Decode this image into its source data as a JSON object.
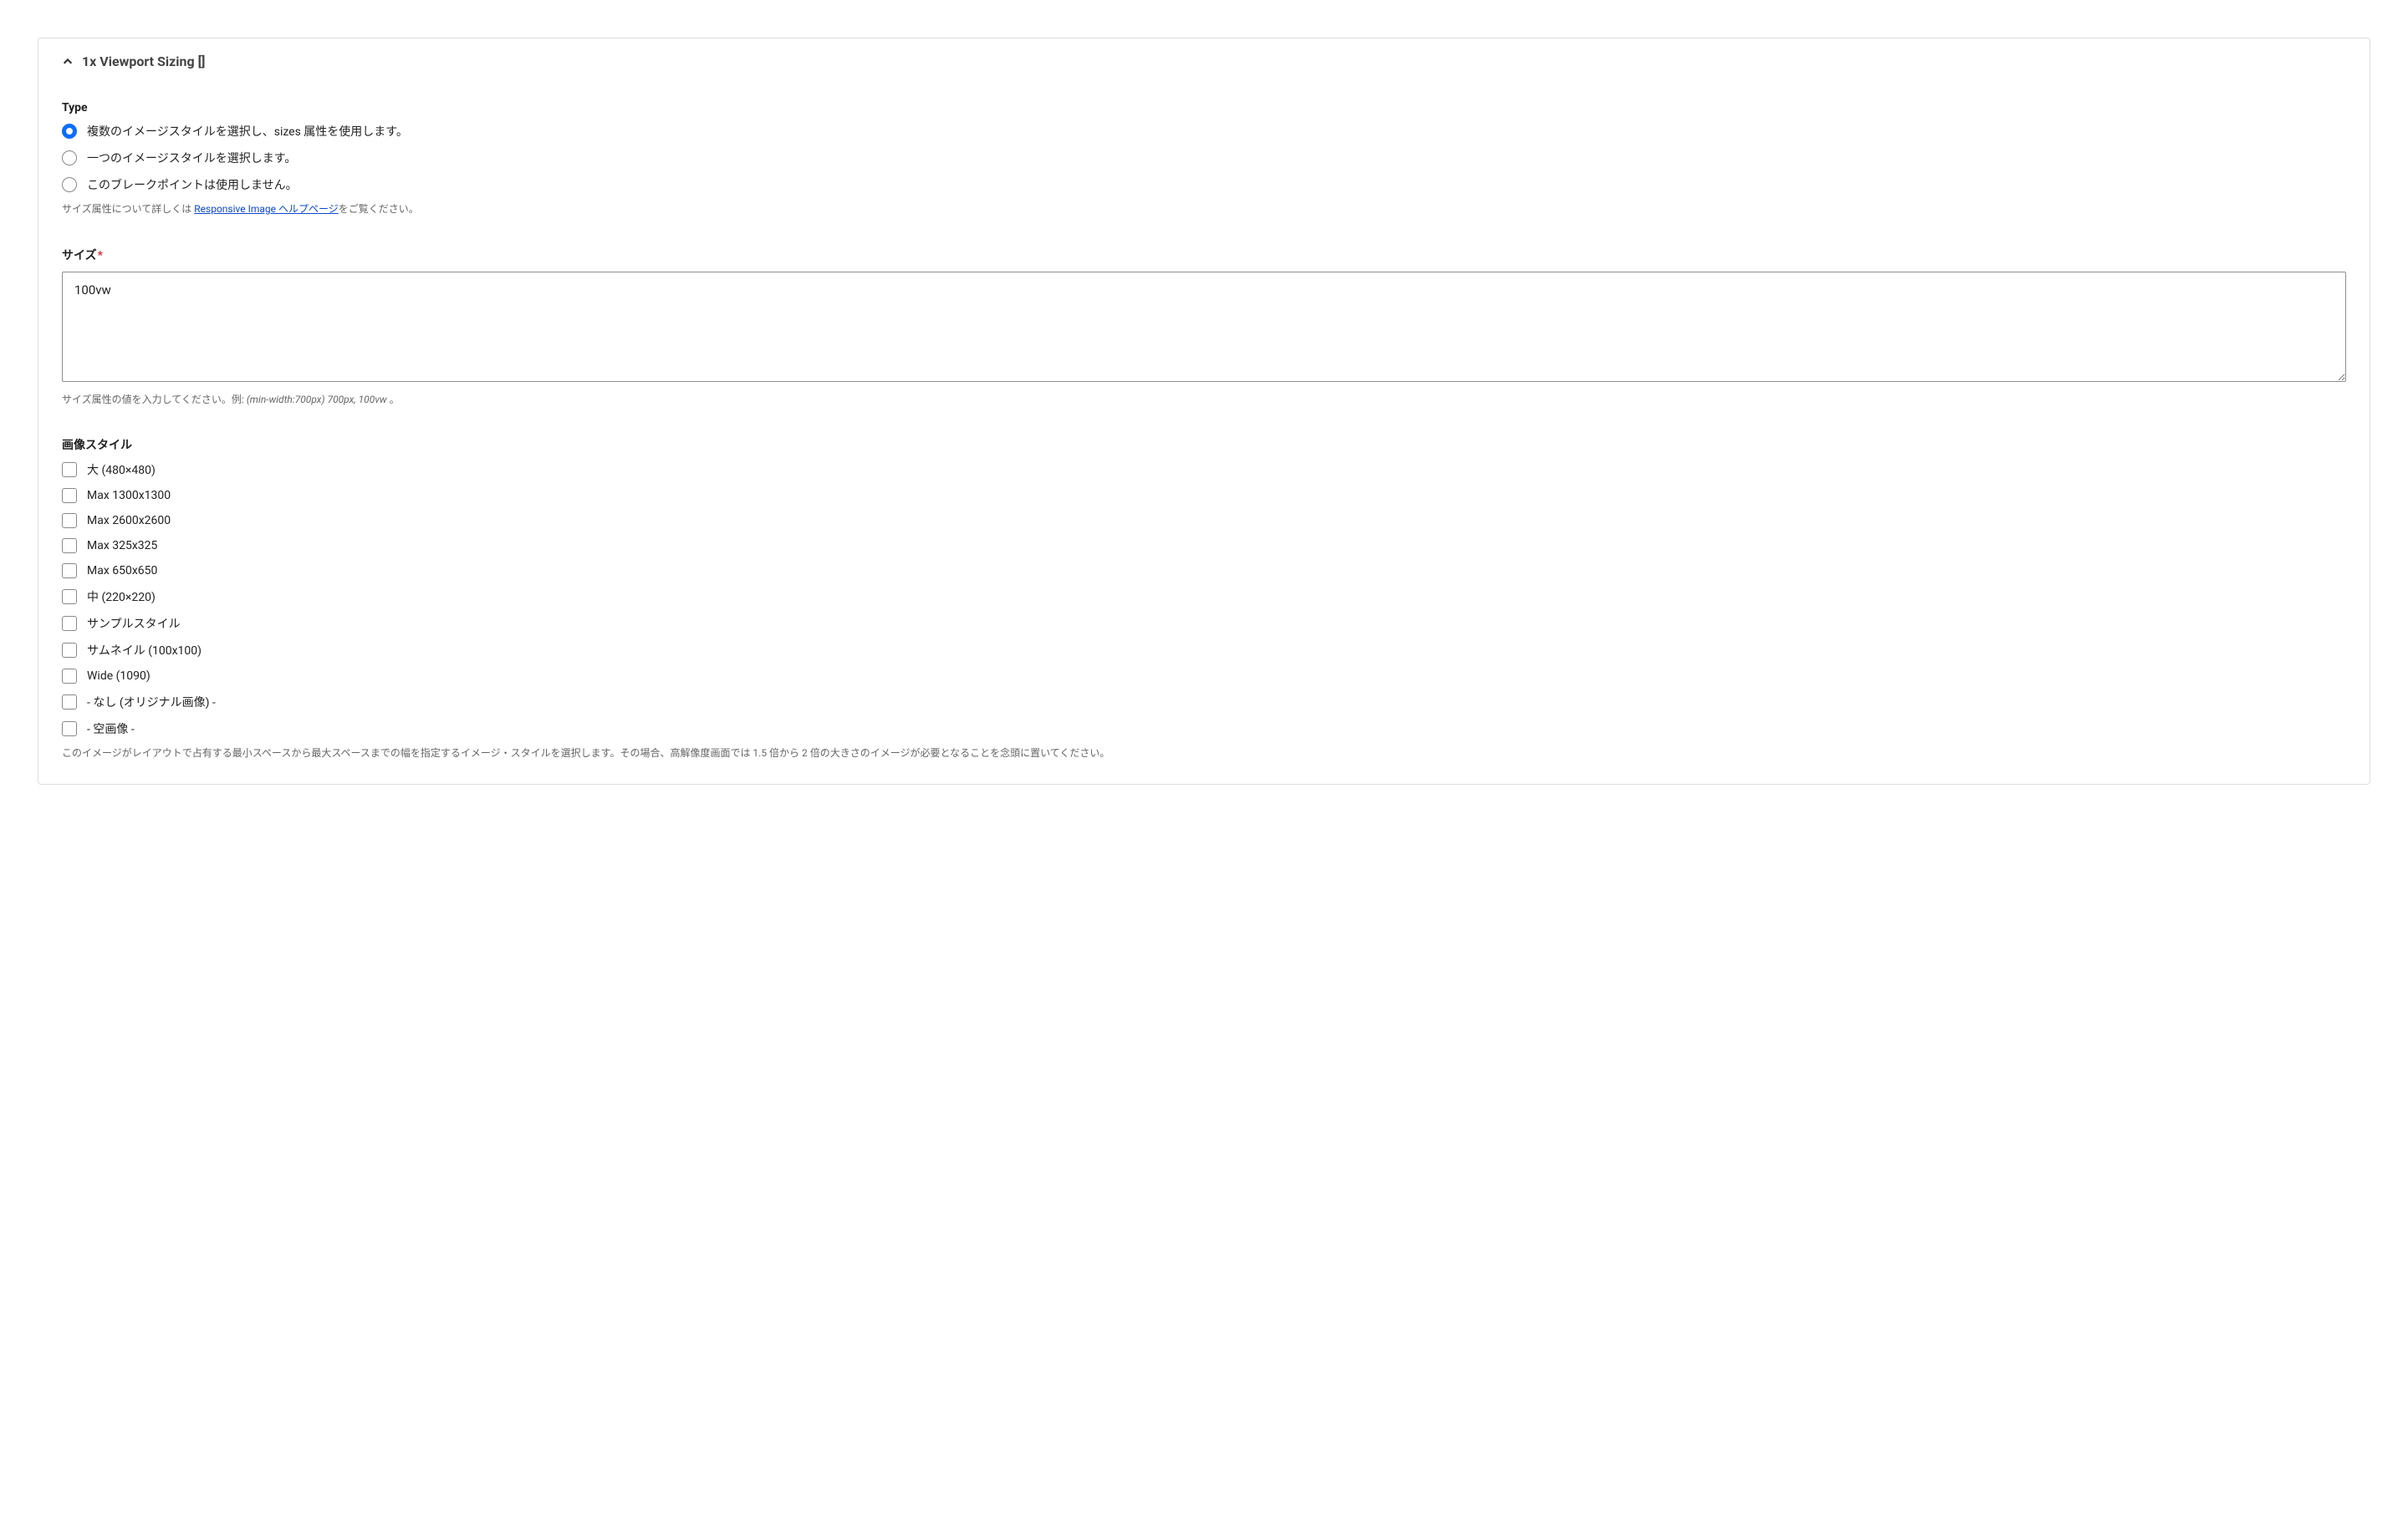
{
  "panel": {
    "title": "1x Viewport Sizing []"
  },
  "type_section": {
    "label": "Type",
    "options": [
      "複数のイメージスタイルを選択し、sizes 属性を使用します。",
      "一つのイメージスタイルを選択します。",
      "このブレークポイントは使用しません。"
    ],
    "help_prefix": "サイズ属性について詳しくは ",
    "help_link_text": "Responsive Image ヘルプページ",
    "help_suffix": "をご覧ください。"
  },
  "size_section": {
    "label": "サイズ",
    "value": "100vw",
    "hint_prefix": "サイズ属性の値を入力してください。例: ",
    "hint_example": "(min-width:700px) 700px, 100vw",
    "hint_suffix": " 。"
  },
  "styles_section": {
    "label": "画像スタイル",
    "options": [
      "大 (480×480)",
      "Max 1300x1300",
      "Max 2600x2600",
      "Max 325x325",
      "Max 650x650",
      "中 (220×220)",
      "サンプルスタイル",
      "サムネイル (100x100)",
      "Wide (1090)",
      "- なし (オリジナル画像) -",
      "- 空画像 -"
    ],
    "help": "このイメージがレイアウトで占有する最小スペースから最大スペースまでの幅を指定するイメージ・スタイルを選択します。その場合、高解像度画面では 1.5 倍から 2 倍の大きさのイメージが必要となることを念頭に置いてください。"
  }
}
